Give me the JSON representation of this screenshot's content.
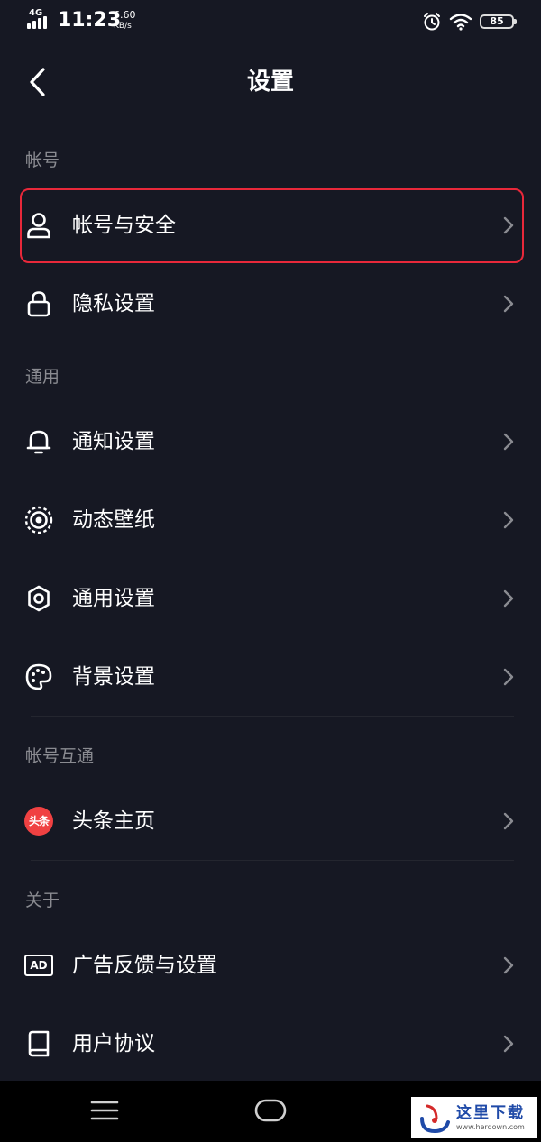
{
  "status_bar": {
    "network": "4G",
    "time": "11:23",
    "speed_value": "6.60",
    "speed_unit": "KB/s",
    "battery": "85"
  },
  "header": {
    "title": "设置"
  },
  "sections": [
    {
      "title": "帐号",
      "items": [
        {
          "label": "帐号与安全",
          "icon": "user-icon"
        },
        {
          "label": "隐私设置",
          "icon": "lock-icon"
        }
      ]
    },
    {
      "title": "通用",
      "items": [
        {
          "label": "通知设置",
          "icon": "bell-icon"
        },
        {
          "label": "动态壁纸",
          "icon": "live-wallpaper-icon"
        },
        {
          "label": "通用设置",
          "icon": "gear-icon"
        },
        {
          "label": "背景设置",
          "icon": "palette-icon"
        }
      ]
    },
    {
      "title": "帐号互通",
      "items": [
        {
          "label": "头条主页",
          "icon": "toutiao-logo-icon"
        }
      ]
    },
    {
      "title": "关于",
      "items": [
        {
          "label": "广告反馈与设置",
          "icon": "ad-icon"
        },
        {
          "label": "用户协议",
          "icon": "book-icon"
        }
      ]
    }
  ],
  "toutiao_logo_text": "头条",
  "ad_icon_text": "AD",
  "colors": {
    "background": "#161823",
    "highlight_border": "#e8283a",
    "section_title": "#8a8b91",
    "toutiao_red": "#f04142"
  },
  "watermark": {
    "text": "这里下载",
    "url_text": "www.herdown.com"
  }
}
